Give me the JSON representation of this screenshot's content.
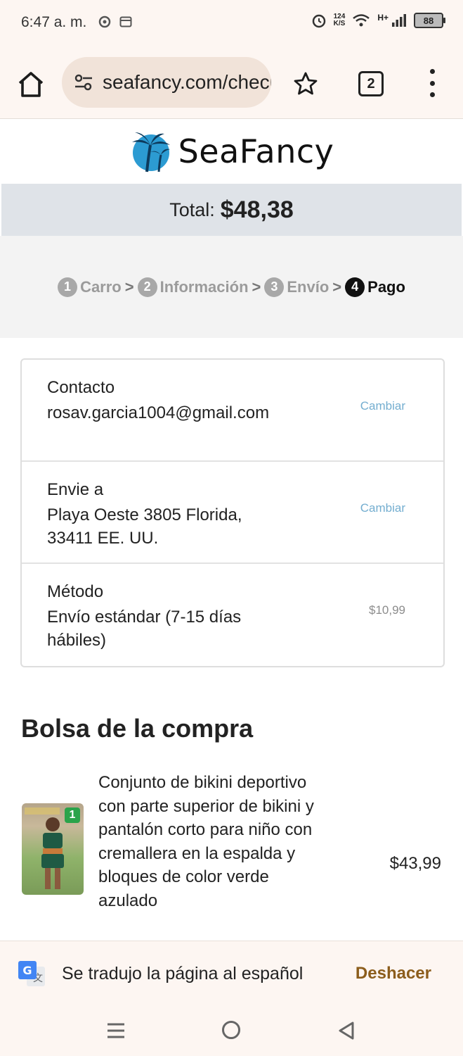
{
  "status_bar": {
    "time": "6:47 a. m.",
    "speed_value": "124",
    "speed_unit": "K/S",
    "network": "H+",
    "battery": "88"
  },
  "browser": {
    "url": "seafancy.com/checkout",
    "tab_count": "2"
  },
  "site": {
    "brand": "SeaFancy"
  },
  "checkout": {
    "total_label": "Total:",
    "total_value": "$48,38",
    "steps": [
      {
        "num": "1",
        "label": "Carro"
      },
      {
        "num": "2",
        "label": "Información"
      },
      {
        "num": "3",
        "label": "Envío"
      },
      {
        "num": "4",
        "label": "Pago"
      }
    ],
    "separator": ">",
    "contact": {
      "label": "Contacto",
      "value": "rosav.garcia1004@gmail.com",
      "action": "Cambiar"
    },
    "ship_to": {
      "label": "Envie a",
      "value": "Playa Oeste 3805 Florida, 33411 EE. UU.",
      "action": "Cambiar"
    },
    "method": {
      "label": "Método",
      "value": "Envío estándar (7-15 días hábiles)",
      "price": "$10,99"
    }
  },
  "bag": {
    "title": "Bolsa de la compra",
    "item": {
      "name": "Conjunto de bikini deportivo con parte superior de bikini y pantalón corto para niño con cremallera en la espalda y bloques de color verde azulado",
      "price": "$43,99",
      "quantity": "1"
    }
  },
  "translate_bar": {
    "message": "Se tradujo la página al español",
    "undo": "Deshacer"
  },
  "colors": {
    "link": "#74aed0",
    "undo": "#8c5d1c",
    "total_bar": "#dfe3e8"
  }
}
